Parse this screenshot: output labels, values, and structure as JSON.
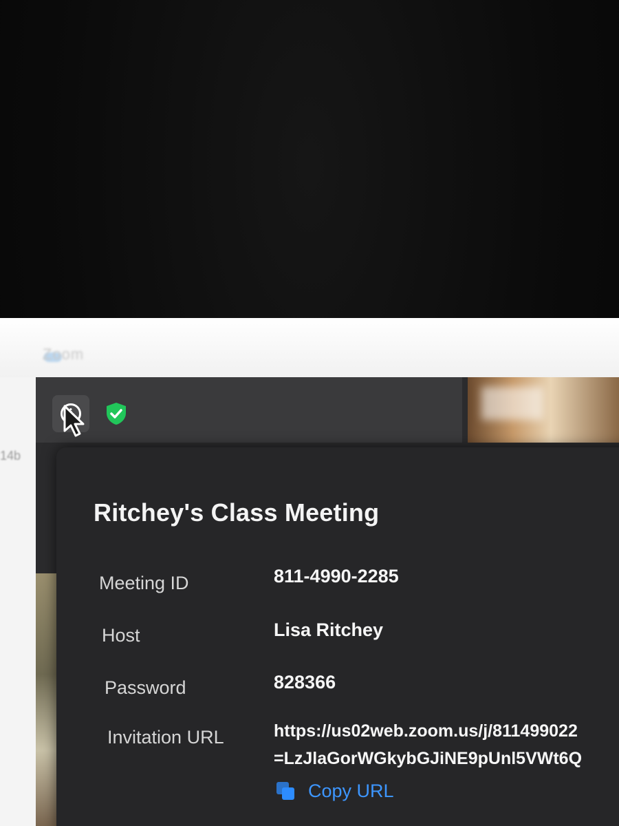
{
  "app": {
    "title": "Zoom"
  },
  "side_fragment": "14b",
  "toolbar": {
    "info_icon": "info-icon",
    "shield_icon": "shield-check-icon",
    "shield_color": "#21c65a"
  },
  "meeting_info": {
    "title": "Ritchey's Class Meeting",
    "meeting_id_label": "Meeting ID",
    "meeting_id": "811-4990-2285",
    "host_label": "Host",
    "host": "Lisa Ritchey",
    "password_label": "Password",
    "password": "828366",
    "invitation_url_label": "Invitation URL",
    "invitation_url_line1": "https://us02web.zoom.us/j/811499022",
    "invitation_url_line2": "=LzJlaGorWGkybGJiNE9pUnl5VWt6Q",
    "copy_url_label": "Copy URL"
  },
  "colors": {
    "accent": "#2d8cff",
    "popup_bg": "#262628"
  }
}
